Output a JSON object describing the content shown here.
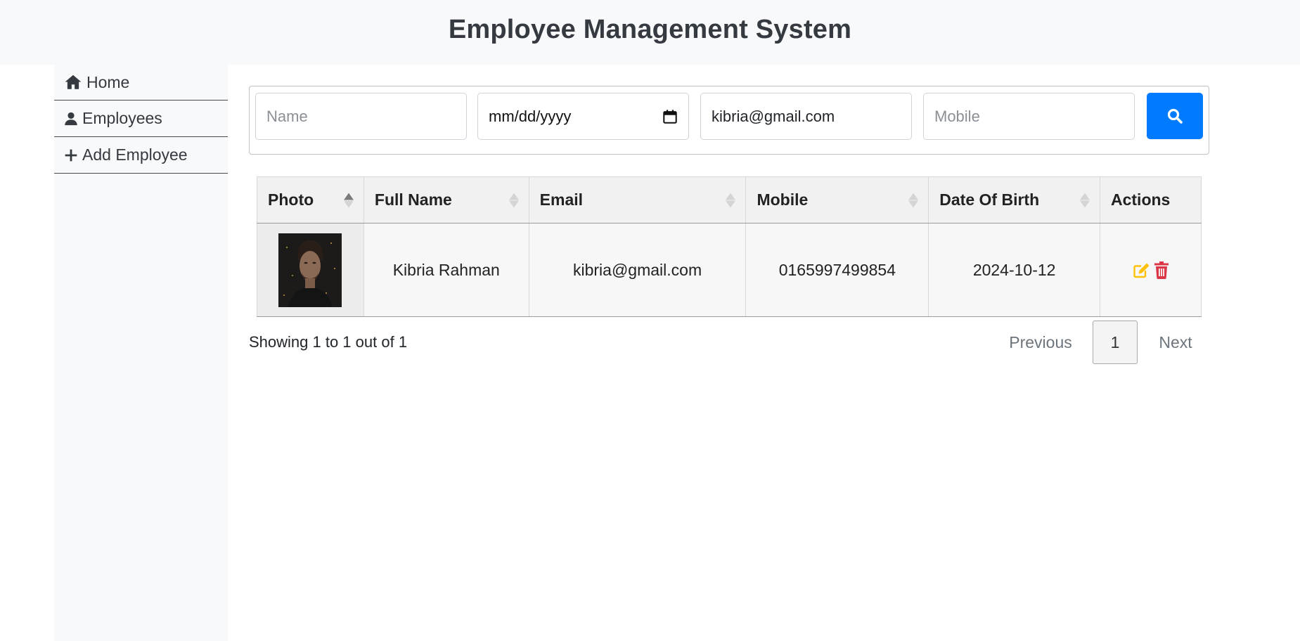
{
  "header": {
    "title": "Employee Management System"
  },
  "sidebar": {
    "items": [
      {
        "label": "Home",
        "icon": "home-icon"
      },
      {
        "label": "Employees",
        "icon": "user-icon"
      },
      {
        "label": "Add Employee",
        "icon": "plus-icon"
      }
    ]
  },
  "search": {
    "name_placeholder": "Name",
    "date_placeholder": "mm/dd/yyyy",
    "email_value": "kibria@gmail.com",
    "mobile_placeholder": "Mobile",
    "button_icon": "search-icon",
    "button_color": "#007bff"
  },
  "table": {
    "columns": [
      "Photo",
      "Full Name",
      "Email",
      "Mobile",
      "Date Of Birth",
      "Actions"
    ],
    "sorted_column": "Photo",
    "rows": [
      {
        "photo": "employee-photo",
        "full_name": "Kibria Rahman",
        "email": "kibria@gmail.com",
        "mobile": "0165997499854",
        "dob": "2024-10-12",
        "actions": [
          "edit-icon",
          "trash-icon"
        ]
      }
    ]
  },
  "pagination": {
    "info": "Showing 1 to 1 out of 1",
    "previous": "Previous",
    "current_page": "1",
    "next": "Next"
  },
  "colors": {
    "edit": "#ffc107",
    "delete": "#dc3545"
  }
}
